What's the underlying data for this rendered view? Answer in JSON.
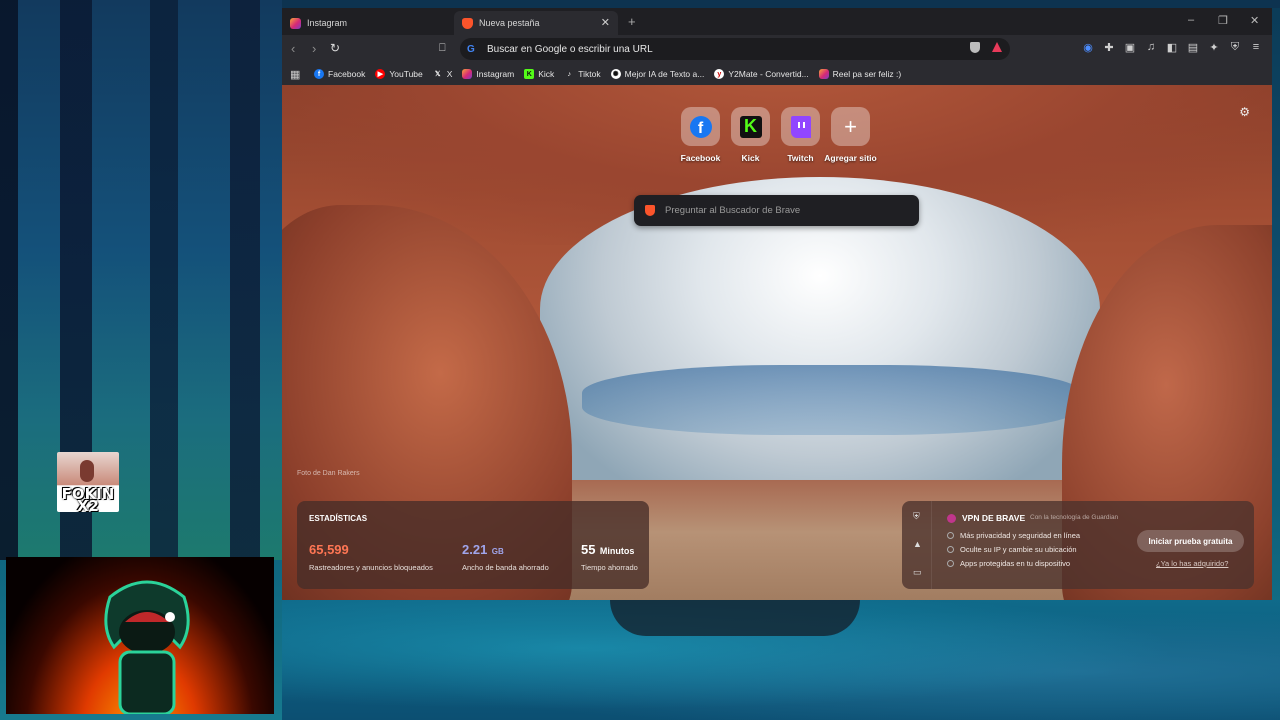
{
  "window": {
    "tabs": [
      {
        "label": "Instagram",
        "active": false,
        "icon": "instagram-icon"
      },
      {
        "label": "Nueva pestaña",
        "active": true,
        "icon": "brave-icon"
      }
    ]
  },
  "toolbar": {
    "address": "Buscar en Google o escribir una URL"
  },
  "bookmarks": [
    {
      "label": "Facebook",
      "icon": "facebook-icon",
      "color": "#1877f2"
    },
    {
      "label": "YouTube",
      "icon": "youtube-icon",
      "color": "#ff0000"
    },
    {
      "label": "X",
      "icon": "x-icon",
      "color": "#000000"
    },
    {
      "label": "Instagram",
      "icon": "instagram-icon",
      "color": "#d62976"
    },
    {
      "label": "Kick",
      "icon": "kick-icon",
      "color": "#53fc18"
    },
    {
      "label": "Tiktok",
      "icon": "tiktok-icon",
      "color": "#000000"
    },
    {
      "label": "Mejor IA de Texto a...",
      "icon": "openai-icon",
      "color": "#ffffff"
    },
    {
      "label": "Y2Mate - Convertid...",
      "icon": "y2mate-icon",
      "color": "#ffffff"
    },
    {
      "label": "Reel pa ser feliz :)",
      "icon": "instagram-icon",
      "color": "#d62976"
    }
  ],
  "ntp": {
    "tiles": [
      {
        "label": "Facebook"
      },
      {
        "label": "Kick"
      },
      {
        "label": "Twitch"
      },
      {
        "label": "Agregar sitio"
      }
    ],
    "search_placeholder": "Preguntar al Buscador de Brave",
    "photo_credit": "Foto de Dan Rakers",
    "stats": {
      "heading": "ESTADÍSTICAS",
      "trackers_value": "65,599",
      "trackers_label": "Rastreadores y anuncios bloqueados",
      "bandwidth_value": "2.21",
      "bandwidth_unit": "GB",
      "bandwidth_label": "Ancho de banda ahorrado",
      "time_value": "55",
      "time_unit": "Minutos",
      "time_label": "Tiempo ahorrado",
      "colors": {
        "trackers": "#ff7654",
        "bandwidth": "#a0a5eb",
        "time": "#ffffff"
      }
    },
    "vpn": {
      "title": "VPN DE BRAVE",
      "powered_by": "Con la tecnología de Guardian",
      "features": [
        "Más privacidad y seguridad en línea",
        "Oculte su IP y cambie su ubicación",
        "Apps protegidas en tu dispositivo"
      ],
      "cta": "Iniciar prueba gratuita",
      "link": "¿Ya lo has adquirido?"
    }
  },
  "overlay": {
    "badge_text": "FOKIN X2"
  }
}
